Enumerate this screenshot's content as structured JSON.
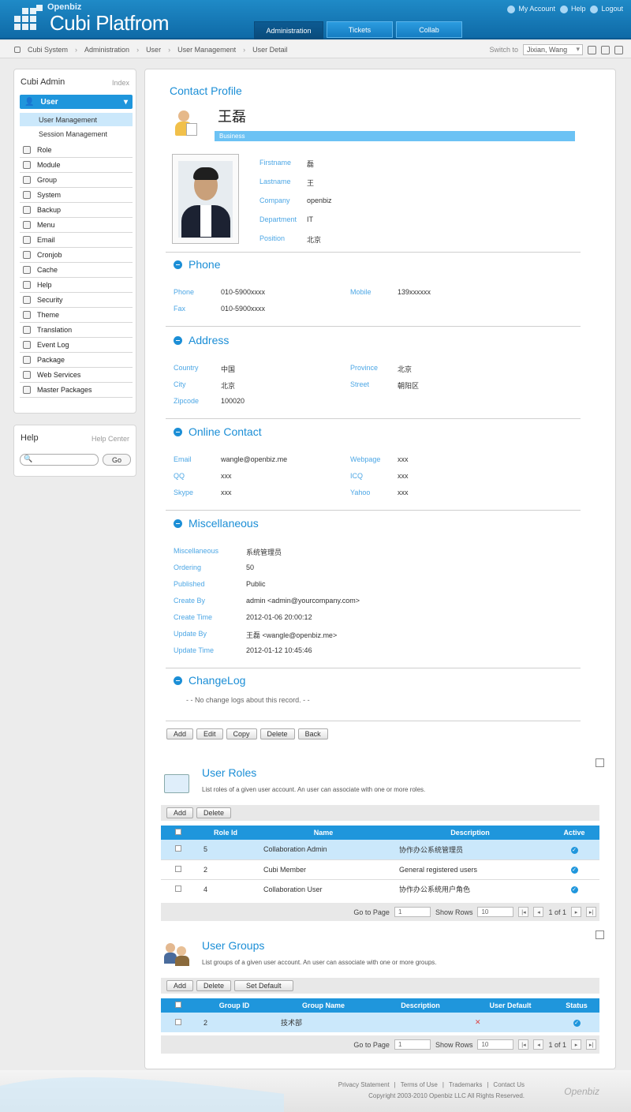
{
  "app": {
    "sup": "Openbiz",
    "title": "Cubi Platfrom"
  },
  "toplinks": {
    "account": "My Account",
    "help": "Help",
    "logout": "Logout"
  },
  "tabs": [
    {
      "label": "Administration"
    },
    {
      "label": "Tickets"
    },
    {
      "label": "Collab"
    }
  ],
  "breadcrumb": [
    "Cubi System",
    "Administration",
    "User",
    "User Management",
    "User Detail"
  ],
  "switch": {
    "label": "Switch to",
    "value": "Jixian, Wang"
  },
  "sidebar": {
    "title": "Cubi Admin",
    "index": "Index",
    "head": "User",
    "subs": [
      "User Management",
      "Session Management"
    ],
    "items": [
      "Role",
      "Module",
      "Group",
      "System",
      "Backup",
      "Menu",
      "Email",
      "Cronjob",
      "Cache",
      "Help",
      "Security",
      "Theme",
      "Translation",
      "Event Log",
      "Package",
      "Web Services",
      "Master Packages"
    ]
  },
  "help": {
    "title": "Help",
    "center": "Help Center",
    "go": "Go"
  },
  "profile": {
    "title": "Contact Profile",
    "name": "王磊",
    "tag": "Business",
    "fields": [
      {
        "label": "Firstname",
        "value": "磊"
      },
      {
        "label": "Lastname",
        "value": "王"
      },
      {
        "label": "Company",
        "value": "openbiz"
      },
      {
        "label": "Department",
        "value": "IT"
      },
      {
        "label": "Position",
        "value": "北京"
      }
    ]
  },
  "phone": {
    "title": "Phone",
    "phone_l": "Phone",
    "phone": "010-5900xxxx",
    "mobile_l": "Mobile",
    "mobile": "139xxxxxx",
    "fax_l": "Fax",
    "fax": "010-5900xxxx"
  },
  "address": {
    "title": "Address",
    "country_l": "Country",
    "country": "中国",
    "province_l": "Province",
    "province": "北京",
    "city_l": "City",
    "city": "北京",
    "street_l": "Street",
    "street": "朝阳区",
    "zip_l": "Zipcode",
    "zip": "100020"
  },
  "online": {
    "title": "Online Contact",
    "email_l": "Email",
    "email": "wangle@openbiz.me",
    "web_l": "Webpage",
    "web": "xxx",
    "qq_l": "QQ",
    "qq": "xxx",
    "icq_l": "ICQ",
    "icq": "xxx",
    "skype_l": "Skype",
    "skype": "xxx",
    "yahoo_l": "Yahoo",
    "yahoo": "xxx"
  },
  "misc": {
    "title": "Miscellaneous",
    "rows": [
      {
        "label": "Miscellaneous",
        "value": "系统管理员"
      },
      {
        "label": "Ordering",
        "value": "50"
      },
      {
        "label": "Published",
        "value": "Public"
      },
      {
        "label": "Create By",
        "value": "admin <admin@yourcompany.com>"
      },
      {
        "label": "Create Time",
        "value": "2012-01-06 20:00:12"
      },
      {
        "label": "Update By",
        "value": "王磊 <wangle@openbiz.me>"
      },
      {
        "label": "Update Time",
        "value": "2012-01-12 10:45:46"
      }
    ]
  },
  "changelog": {
    "title": "ChangeLog",
    "empty": "- - No change logs about this record. - -"
  },
  "actions": [
    "Add",
    "Edit",
    "Copy",
    "Delete",
    "Back"
  ],
  "roles": {
    "title": "User Roles",
    "desc": "List roles of a given user account. An user can associate with one or more roles.",
    "buttons": [
      "Add",
      "Delete"
    ],
    "headers": [
      "Role Id",
      "Name",
      "Description",
      "Active"
    ],
    "rows": [
      {
        "id": "5",
        "name": "Collaboration Admin",
        "desc": "协作办公系统管理员"
      },
      {
        "id": "2",
        "name": "Cubi Member",
        "desc": "General registered users"
      },
      {
        "id": "4",
        "name": "Collaboration User",
        "desc": "协作办公系统用户角色"
      }
    ]
  },
  "groups": {
    "title": "User Groups",
    "desc": "List groups of a given user account. An user can associate with one or more groups.",
    "buttons": [
      "Add",
      "Delete",
      "Set Default"
    ],
    "headers": [
      "Group ID",
      "Group Name",
      "Description",
      "User Default",
      "Status"
    ],
    "rows": [
      {
        "id": "2",
        "name": "技术部",
        "desc": ""
      }
    ]
  },
  "pager": {
    "goto": "Go to Page",
    "page": "1",
    "show": "Show Rows",
    "rows": "10",
    "of": "1 of 1"
  },
  "footer": {
    "links": [
      "Privacy Statement",
      "|",
      "Terms of Use",
      "|",
      "Trademarks",
      "|",
      "Contact Us"
    ],
    "copy": "Copyright 2003-2010 Openbiz LLC All Rights Reserved.",
    "logo": "Openbiz"
  }
}
